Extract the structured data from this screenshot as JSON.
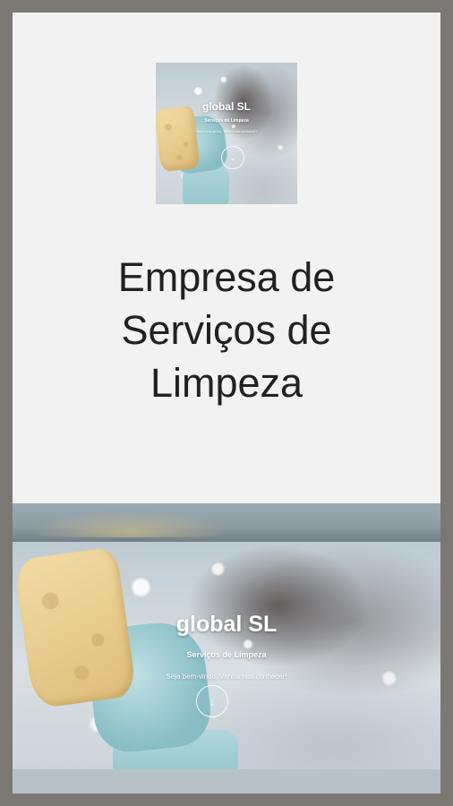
{
  "thumbnail": {
    "brand": "global SL",
    "tagline": "Serviços de Limpeza",
    "welcome": "Seja bem-vindo, Venha nos conhecer!",
    "scroll_icon": "chevron-down-icon",
    "scroll_glyph": "⌄"
  },
  "headline": {
    "lines": [
      "Empresa de",
      "Serviços de",
      "Limpeza"
    ]
  },
  "banner": {
    "brand": "global SL",
    "tagline": "Serviços de Limpeza",
    "welcome": "Seja bem-vindo, Venha nos conhecer!",
    "scroll_icon": "chevron-down-icon",
    "scroll_glyph": "↓"
  },
  "colors": {
    "frame": "#7b7873",
    "card": "#f2f2f2",
    "headline_text": "#212121",
    "glove": "#8cc0c6",
    "sponge": "#e8c985"
  }
}
